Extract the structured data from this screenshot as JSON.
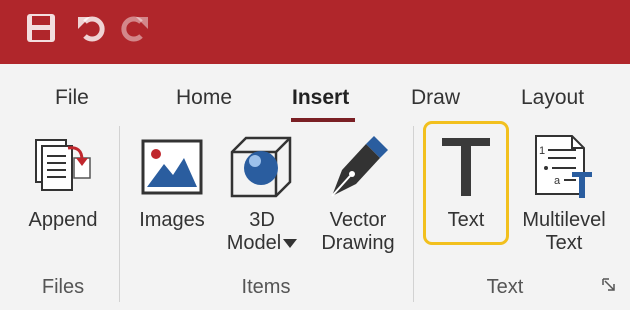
{
  "quick_access": {
    "save_icon": "save-icon",
    "undo_icon": "undo-icon",
    "redo_icon": "redo-icon"
  },
  "tabs": [
    "File",
    "Home",
    "Insert",
    "Draw",
    "Layout"
  ],
  "active_tab": "Insert",
  "groups": {
    "files": {
      "label": "Files",
      "buttons": {
        "append": "Append"
      }
    },
    "items": {
      "label": "Items",
      "buttons": {
        "images": "Images",
        "model_line1": "3D",
        "model_line2": "Model",
        "vector_line1": "Vector",
        "vector_line2": "Drawing"
      }
    },
    "text": {
      "label": "Text",
      "buttons": {
        "text": "Text",
        "multilevel_line1": "Multilevel",
        "multilevel_line2": "Text"
      }
    }
  },
  "colors": {
    "title_bar": "#b0262b",
    "active_underline": "#7a1f24",
    "highlight": "#f2c01e",
    "icon_blue": "#2a5d9f"
  },
  "icons": {
    "multilevel_markers": [
      "1",
      "a"
    ]
  }
}
